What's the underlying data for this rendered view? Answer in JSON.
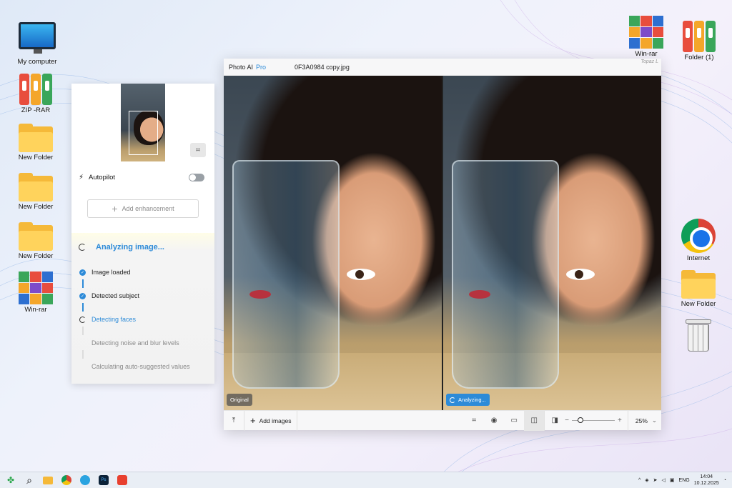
{
  "desktop": {
    "icons": [
      {
        "label": "My computer"
      },
      {
        "label": "ZIP -RAR"
      },
      {
        "label": "New Folder"
      },
      {
        "label": "New Folder"
      },
      {
        "label": "New Folder"
      },
      {
        "label": "Win-rar"
      },
      {
        "label": "Win-rar"
      },
      {
        "label": "Folder (1)"
      },
      {
        "label": "Internet"
      },
      {
        "label": "New Folder"
      },
      {
        "label": ""
      }
    ]
  },
  "window": {
    "app_name": "Photo AI",
    "app_tier": "Pro",
    "file_name": "0F3A0984 copy.jpg",
    "brand": "Topaz L",
    "left_tag": "Original",
    "right_tag": "Analyzing..."
  },
  "toolbar": {
    "add_images": "Add images",
    "zoom": "25%",
    "zoom_level": 0.2
  },
  "panel": {
    "autopilot_label": "Autopilot",
    "autopilot_on": false,
    "add_enhancement": "Add enhancement",
    "analysis_title": "Analyzing image...",
    "steps": [
      {
        "label": "Image loaded",
        "state": "done"
      },
      {
        "label": "Detected subject",
        "state": "done"
      },
      {
        "label": "Detecting faces",
        "state": "active"
      },
      {
        "label": "Detecting noise and blur levels",
        "state": "pending"
      },
      {
        "label": "Calculating auto-suggested values",
        "state": "pending"
      }
    ]
  },
  "taskbar": {
    "lang": "ENG",
    "time": "14:04",
    "date": "10.12.2025"
  },
  "colors": {
    "accent": "#2d8bd8",
    "taskbar": "#e9eef5"
  }
}
